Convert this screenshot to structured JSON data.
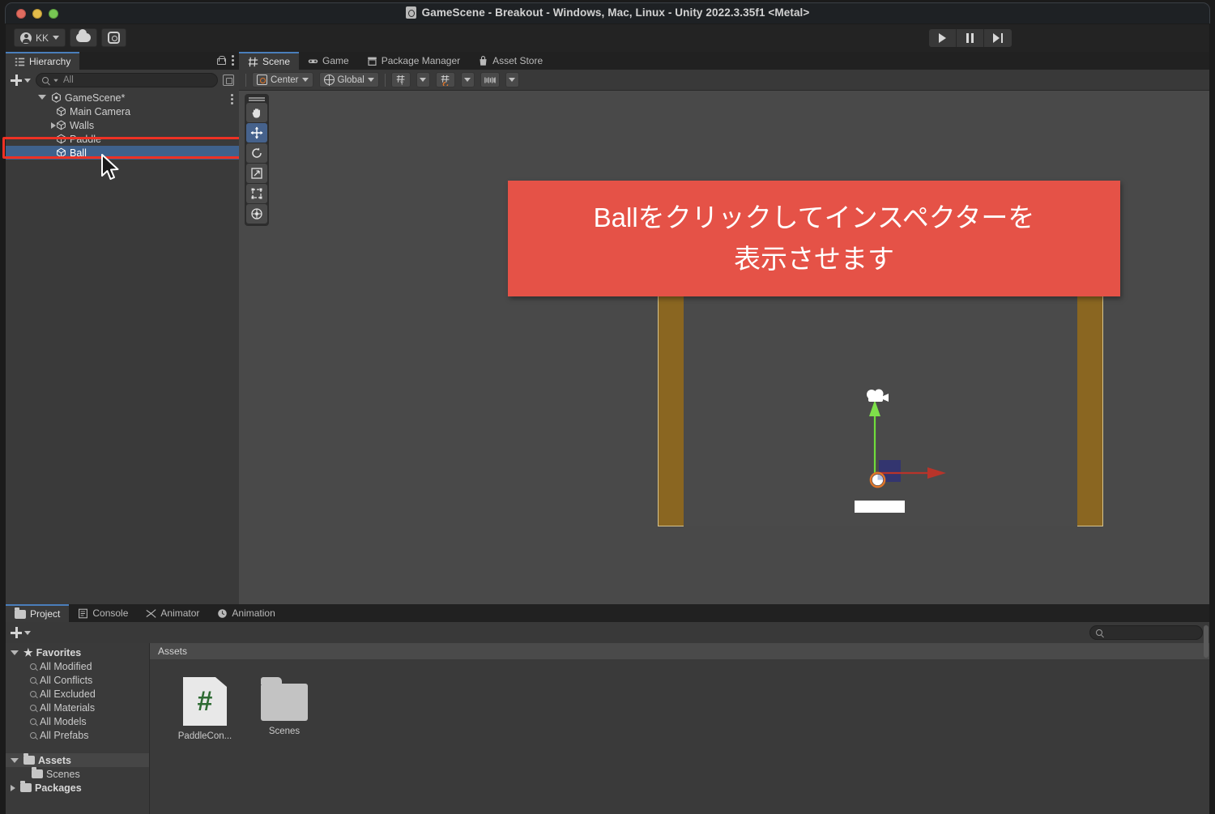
{
  "window": {
    "title": "GameScene - Breakout - Windows, Mac, Linux - Unity 2022.3.35f1 <Metal>",
    "doc_icon": "unity-document-icon",
    "traffic_lights": [
      "close",
      "minimize",
      "zoom"
    ]
  },
  "toolbar": {
    "account_label": "KK",
    "account_icon": "account-icon",
    "cloud_icon": "cloud-icon",
    "settings_icon": "gear-icon",
    "play_label": "Play",
    "pause_label": "Pause",
    "step_label": "Step"
  },
  "hierarchy": {
    "tab_label": "Hierarchy",
    "tab_icon": "hierarchy-icon",
    "lock_icon": "lock-icon",
    "menu_icon": "kebab-menu-icon",
    "add_icon": "plus-icon",
    "search_placeholder": "All",
    "search_value": "",
    "items": [
      {
        "label": "GameScene*",
        "indent": 0,
        "arrow": "open",
        "icon": "scene-icon",
        "selected": false
      },
      {
        "label": "Main Camera",
        "indent": 1,
        "arrow": "none",
        "icon": "gameobject-icon",
        "selected": false
      },
      {
        "label": "Walls",
        "indent": 1,
        "arrow": "closed",
        "icon": "gameobject-icon",
        "selected": false
      },
      {
        "label": "Paddle",
        "indent": 1,
        "arrow": "none",
        "icon": "gameobject-icon",
        "selected": false
      },
      {
        "label": "Ball",
        "indent": 1,
        "arrow": "none",
        "icon": "gameobject-icon",
        "selected": true
      }
    ]
  },
  "scene": {
    "tabs": [
      {
        "label": "Scene",
        "icon": "scene-grid-icon",
        "active": true
      },
      {
        "label": "Game",
        "icon": "gamepad-icon",
        "active": false
      },
      {
        "label": "Package Manager",
        "icon": "package-icon",
        "active": false
      },
      {
        "label": "Asset Store",
        "icon": "store-bag-icon",
        "active": false
      }
    ],
    "toolbar": {
      "pivot_label": "Center",
      "pivot_icon": "pivot-center-icon",
      "handle_label": "Global",
      "handle_icon": "globe-icon",
      "grid_visibility_icon": "grid-axis-icon",
      "grid_snapping_icon": "grid-snap-icon",
      "scale_ruler_icon": "ruler-icon"
    },
    "tools": [
      {
        "name": "hand-tool",
        "selected": false
      },
      {
        "name": "move-tool",
        "selected": true
      },
      {
        "name": "rotate-tool",
        "selected": false
      },
      {
        "name": "scale-tool",
        "selected": false
      },
      {
        "name": "rect-tool",
        "selected": false
      },
      {
        "name": "transform-tool",
        "selected": false
      }
    ],
    "objects": {
      "walls_color": "#8a6621",
      "paddle_color": "#ffffff",
      "block_color": "#33356f",
      "ball_ring_color": "#e0762a",
      "axis_y_color": "#6fdc3b",
      "axis_x_color": "#b8342a",
      "camera_gizmo": "camera-gizmo-icon"
    }
  },
  "annotation": {
    "line1": "Ballをクリックしてインスペクターを",
    "line2": "表示させます",
    "background": "#e55247",
    "text_color": "#ffffff"
  },
  "project": {
    "tabs": [
      {
        "label": "Project",
        "icon": "folder-icon",
        "active": true
      },
      {
        "label": "Console",
        "icon": "console-icon",
        "active": false
      },
      {
        "label": "Animator",
        "icon": "animator-icon",
        "active": false
      },
      {
        "label": "Animation",
        "icon": "clock-icon",
        "active": false
      }
    ],
    "add_icon": "plus-icon",
    "search_placeholder": "",
    "search_value": "",
    "tree": [
      {
        "label": "Favorites",
        "indent": 0,
        "arrow": "open",
        "icon": "star-icon",
        "header": true
      },
      {
        "label": "All Modified",
        "indent": 1,
        "arrow": "none",
        "icon": "search-icon",
        "header": false
      },
      {
        "label": "All Conflicts",
        "indent": 1,
        "arrow": "none",
        "icon": "search-icon",
        "header": false
      },
      {
        "label": "All Excluded",
        "indent": 1,
        "arrow": "none",
        "icon": "search-icon",
        "header": false
      },
      {
        "label": "All Materials",
        "indent": 1,
        "arrow": "none",
        "icon": "search-icon",
        "header": false
      },
      {
        "label": "All Models",
        "indent": 1,
        "arrow": "none",
        "icon": "search-icon",
        "header": false
      },
      {
        "label": "All Prefabs",
        "indent": 1,
        "arrow": "none",
        "icon": "search-icon",
        "header": false
      },
      {
        "label": "Assets",
        "indent": 0,
        "arrow": "open",
        "icon": "folder-open-icon",
        "header": true,
        "highlight": true
      },
      {
        "label": "Scenes",
        "indent": 1,
        "arrow": "none",
        "icon": "folder-icon",
        "header": false
      },
      {
        "label": "Packages",
        "indent": 0,
        "arrow": "closed",
        "icon": "folder-icon",
        "header": true
      }
    ],
    "breadcrumb": "Assets",
    "assets": [
      {
        "label": "PaddleCon...",
        "type": "csharp-script",
        "glyph": "#"
      },
      {
        "label": "Scenes",
        "type": "folder",
        "glyph": ""
      }
    ]
  }
}
